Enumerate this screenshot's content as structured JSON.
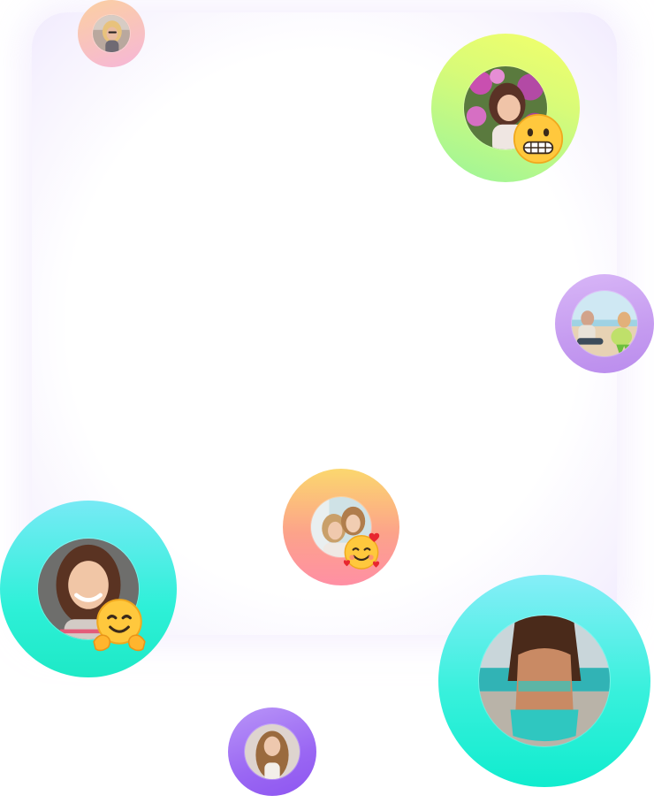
{
  "screen": {
    "background_color": "#ffffff",
    "panel_color": "#f3edfd"
  },
  "avatars": [
    {
      "id": "avatar-top-left-small",
      "ring_colors": [
        "#fbd0a1",
        "#f6b6d8"
      ],
      "emoji": null
    },
    {
      "id": "avatar-top-right-large",
      "ring_colors": [
        "#f4ff6a",
        "#9af59a"
      ],
      "emoji": "grimacing-face"
    },
    {
      "id": "avatar-right-middle",
      "ring_colors": [
        "#d8b6f7",
        "#ba8ced"
      ],
      "emoji": null
    },
    {
      "id": "avatar-center-friends",
      "ring_colors": [
        "#fbd76e",
        "#ff8fa4"
      ],
      "emoji": "smiling-face-with-hearts"
    },
    {
      "id": "avatar-left-bottom-large",
      "ring_colors": [
        "#77eaf5",
        "#1de9c6"
      ],
      "emoji": "hugging-face"
    },
    {
      "id": "avatar-bottom-right-xl",
      "ring_colors": [
        "#86eef8",
        "#10ecce"
      ],
      "emoji": null
    },
    {
      "id": "avatar-bottom-center-small",
      "ring_colors": [
        "#b995f8",
        "#8e55f1"
      ],
      "emoji": null
    }
  ]
}
